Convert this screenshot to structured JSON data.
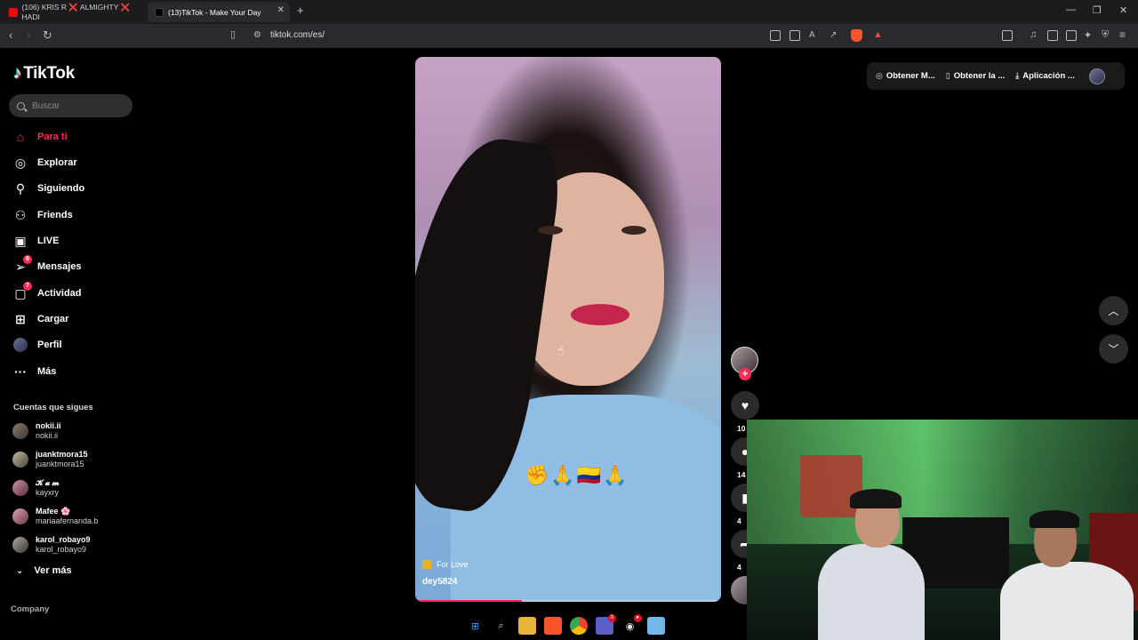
{
  "browser": {
    "tabs": [
      {
        "label": "(106) KRIS R ❌ ALMIGHTY ❌ HADI",
        "icon": "youtube-icon"
      },
      {
        "label": "(13)TikTok - Make Your Day",
        "icon": "tiktok-icon",
        "active": true
      }
    ],
    "url": "tiktok.com/es/"
  },
  "tiktok": {
    "logo": "TikTok",
    "search_placeholder": "Buscar",
    "nav": [
      {
        "label": "Para ti",
        "icon": "home-icon",
        "active": true
      },
      {
        "label": "Explorar",
        "icon": "compass-icon"
      },
      {
        "label": "Siguiendo",
        "icon": "following-icon"
      },
      {
        "label": "Friends",
        "icon": "friends-icon"
      },
      {
        "label": "LIVE",
        "icon": "live-icon"
      },
      {
        "label": "Mensajes",
        "icon": "messages-icon",
        "badge": "6"
      },
      {
        "label": "Actividad",
        "icon": "activity-icon",
        "badge": "7"
      },
      {
        "label": "Cargar",
        "icon": "upload-icon"
      },
      {
        "label": "Perfil",
        "icon": "profile-icon"
      },
      {
        "label": "Más",
        "icon": "more-icon"
      }
    ],
    "following_title": "Cuentas que sigues",
    "following": [
      {
        "name": "nokii.ii",
        "handle": "nokii.ii"
      },
      {
        "name": "juanktmora15",
        "handle": "juanktmora15"
      },
      {
        "name": "𝓚 𝓪 𝓶",
        "handle": "kayxry"
      },
      {
        "name": "Mafee 🌸",
        "handle": "mariaafernanda.b"
      },
      {
        "name": "karol_robayo9",
        "handle": "karol_robayo9"
      }
    ],
    "see_more": "Ver más",
    "footer_section": "Company",
    "video": {
      "emojis": "✊🙏🇨🇴🙏",
      "sound": "For Love",
      "author": "dey5824",
      "progress": 0.35
    },
    "rail": {
      "like_count": "10",
      "comment_count": "14",
      "save_count": "4",
      "share_count": "4"
    },
    "topbar": {
      "coins": "Obtener M...",
      "app": "Obtener la ...",
      "download": "Aplicación ..."
    }
  }
}
